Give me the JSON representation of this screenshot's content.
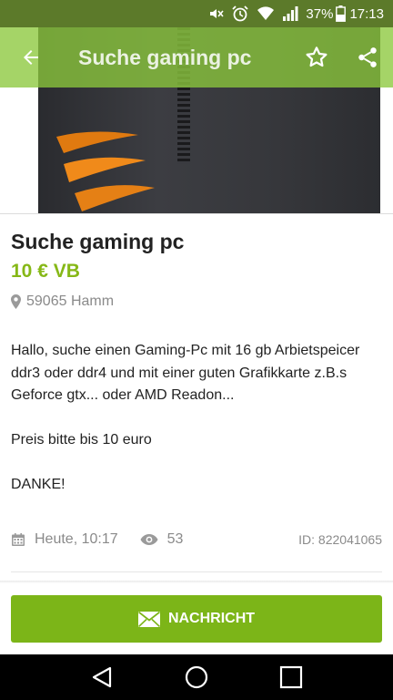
{
  "status_bar": {
    "battery": "37%",
    "time": "17:13",
    "icons": [
      "mute-icon",
      "alarm-icon",
      "wifi-icon",
      "signal-icon",
      "battery-icon"
    ]
  },
  "app_bar": {
    "title": "Suche gaming pc",
    "icons": [
      "back-arrow-icon",
      "star-icon",
      "share-icon"
    ]
  },
  "ad": {
    "title": "Suche gaming pc",
    "price": "10 € VB",
    "location": "59065 Hamm",
    "description": "Hallo, suche einen Gaming-Pc mit 16 gb Arbietspeicer ddr3 oder ddr4 und mit einer guten Grafikkarte z.B.s Geforce gtx... oder AMD Readon...\n\nPreis bitte bis 10 euro\n\nDANKE!",
    "date": "Heute, 10:17",
    "views": "53",
    "id": "ID: 822041065"
  },
  "actions": {
    "message_label": "NACHRICHT"
  },
  "colors": {
    "accent": "#86b817",
    "button": "#7cb518",
    "app_bar": "#8cc83c",
    "status_bar": "#5c7a2a"
  }
}
